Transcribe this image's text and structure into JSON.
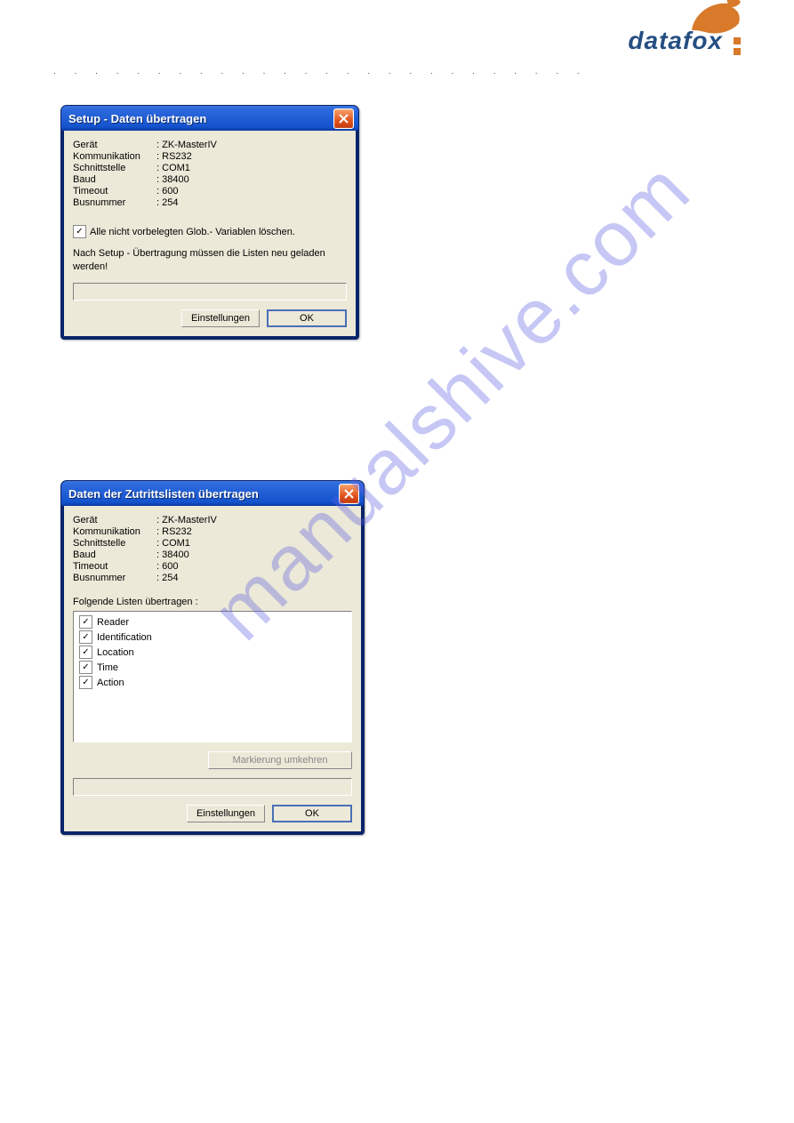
{
  "brand": {
    "name": "datafox"
  },
  "watermark": "manualshive.com",
  "win1": {
    "title": "Setup - Daten übertragen",
    "fields": [
      {
        "label": "Gerät",
        "value": "ZK-MasterIV"
      },
      {
        "label": "Kommunikation",
        "value": "RS232"
      },
      {
        "label": "Schnittstelle",
        "value": "COM1"
      },
      {
        "label": "Baud",
        "value": "38400"
      },
      {
        "label": "Timeout",
        "value": "600"
      },
      {
        "label": "Busnummer",
        "value": "254"
      }
    ],
    "checkbox_label": "Alle nicht vorbelegten Glob.- Variablen löschen.",
    "note": "Nach Setup - Übertragung müssen die Listen neu geladen werden!",
    "buttons": {
      "settings": "Einstellungen",
      "ok": "OK"
    }
  },
  "win2": {
    "title": "Daten der Zutrittslisten übertragen",
    "fields": [
      {
        "label": "Gerät",
        "value": "ZK-MasterIV"
      },
      {
        "label": "Kommunikation",
        "value": "RS232"
      },
      {
        "label": "Schnittstelle",
        "value": "COM1"
      },
      {
        "label": "Baud",
        "value": "38400"
      },
      {
        "label": "Timeout",
        "value": "600"
      },
      {
        "label": "Busnummer",
        "value": "254"
      }
    ],
    "list_label": "Folgende Listen übertragen :",
    "items": [
      {
        "checked": true,
        "label": "Reader"
      },
      {
        "checked": true,
        "label": "Identification"
      },
      {
        "checked": true,
        "label": "Location"
      },
      {
        "checked": true,
        "label": "Time"
      },
      {
        "checked": true,
        "label": "Action"
      }
    ],
    "invert_btn": "Markierung umkehren",
    "buttons": {
      "settings": "Einstellungen",
      "ok": "OK"
    }
  }
}
